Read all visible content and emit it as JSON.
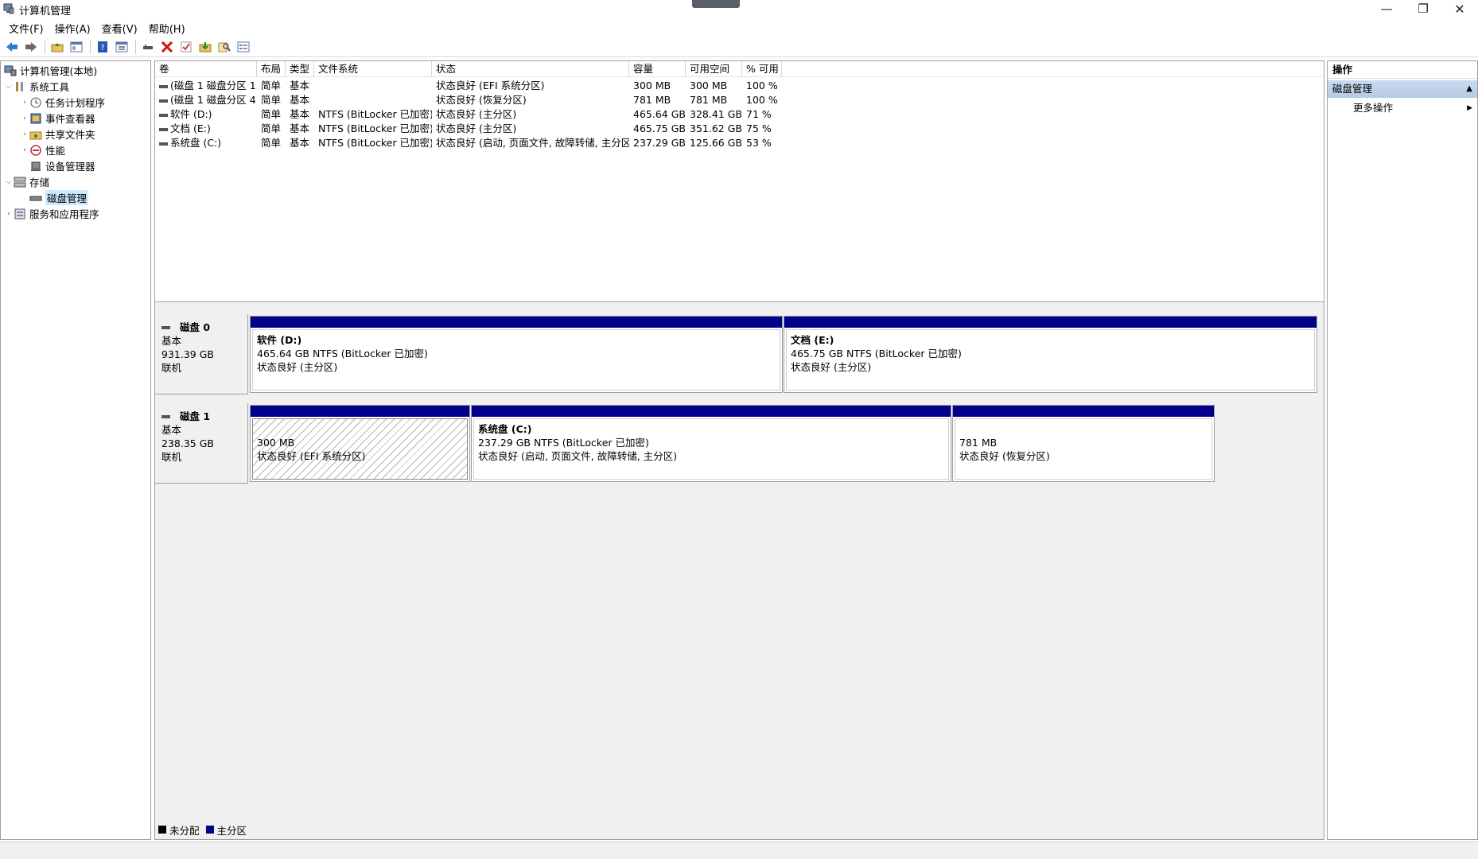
{
  "window": {
    "title": "计算机管理",
    "controls": {
      "minimize": "—",
      "restore": "❐",
      "close": "✕"
    }
  },
  "menu": [
    "文件(F)",
    "操作(A)",
    "查看(V)",
    "帮助(H)"
  ],
  "toolbar_icons": [
    "back-icon",
    "forward-icon",
    "up-folder-icon",
    "show-hide-tree-icon",
    "help-icon",
    "properties-icon",
    "connect-icon",
    "delete-icon",
    "check-icon",
    "new-folder-icon",
    "search-icon",
    "list-icon"
  ],
  "tree": {
    "root": "计算机管理(本地)",
    "system_tools": "系统工具",
    "task_scheduler": "任务计划程序",
    "event_viewer": "事件查看器",
    "shared_folders": "共享文件夹",
    "performance": "性能",
    "device_manager": "设备管理器",
    "storage": "存储",
    "disk_management": "磁盘管理",
    "services_apps": "服务和应用程序"
  },
  "volume_table": {
    "headers": [
      "卷",
      "布局",
      "类型",
      "文件系统",
      "状态",
      "容量",
      "可用空间",
      "% 可用"
    ],
    "rows": [
      [
        "(磁盘 1 磁盘分区 1)",
        "简单",
        "基本",
        "",
        "状态良好 (EFI 系统分区)",
        "300 MB",
        "300 MB",
        "100 %"
      ],
      [
        "(磁盘 1 磁盘分区 4)",
        "简单",
        "基本",
        "",
        "状态良好 (恢复分区)",
        "781 MB",
        "781 MB",
        "100 %"
      ],
      [
        "软件 (D:)",
        "简单",
        "基本",
        "NTFS (BitLocker 已加密)",
        "状态良好 (主分区)",
        "465.64 GB",
        "328.41 GB",
        "71 %"
      ],
      [
        "文档 (E:)",
        "简单",
        "基本",
        "NTFS (BitLocker 已加密)",
        "状态良好 (主分区)",
        "465.75 GB",
        "351.62 GB",
        "75 %"
      ],
      [
        "系统盘 (C:)",
        "简单",
        "基本",
        "NTFS (BitLocker 已加密)",
        "状态良好 (启动, 页面文件, 故障转储, 主分区)",
        "237.29 GB",
        "125.66 GB",
        "53 %"
      ]
    ]
  },
  "disks": [
    {
      "name": "磁盘 0",
      "type": "基本",
      "size": "931.39 GB",
      "status": "联机",
      "partitions": [
        {
          "name": "软件 (D:)",
          "detail": "465.64 GB NTFS (BitLocker 已加密)",
          "status": "状态良好 (主分区)"
        },
        {
          "name": "文档 (E:)",
          "detail": "465.75 GB NTFS (BitLocker 已加密)",
          "status": "状态良好 (主分区)"
        }
      ]
    },
    {
      "name": "磁盘 1",
      "type": "基本",
      "size": "238.35 GB",
      "status": "联机",
      "partitions": [
        {
          "name": "",
          "detail": "300 MB",
          "status": "状态良好 (EFI 系统分区)"
        },
        {
          "name": "系统盘 (C:)",
          "detail": "237.29 GB NTFS (BitLocker 已加密)",
          "status": "状态良好 (启动, 页面文件, 故障转储, 主分区)"
        },
        {
          "name": "",
          "detail": "781 MB",
          "status": "状态良好 (恢复分区)"
        }
      ]
    }
  ],
  "legend": {
    "unallocated": "未分配",
    "primary": "主分区",
    "unallocated_color": "#000000",
    "primary_color": "#00008b"
  },
  "actions": {
    "title": "操作",
    "section": "磁盘管理",
    "more": "更多操作"
  }
}
